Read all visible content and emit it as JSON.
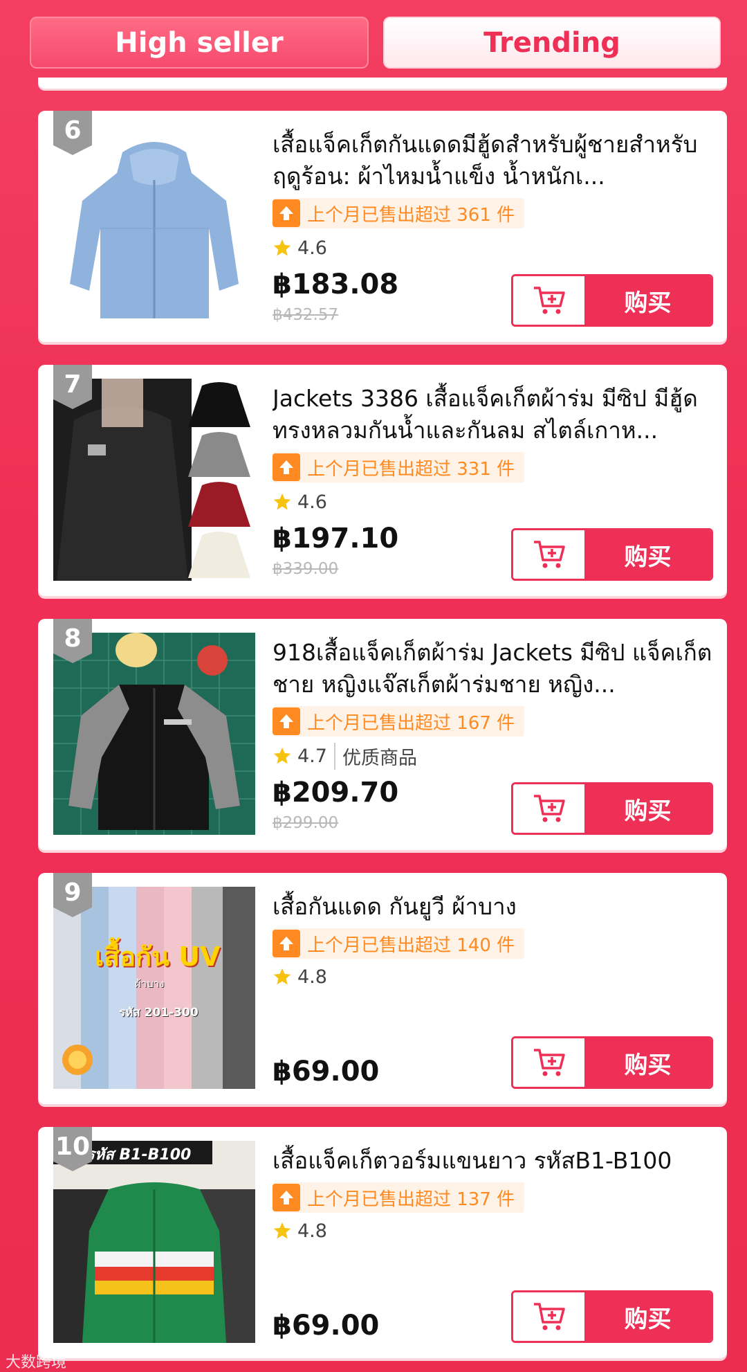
{
  "tabs": {
    "high_seller": "High seller",
    "trending": "Trending"
  },
  "colors": {
    "accent": "#ee2f56",
    "orange": "#ff8a21",
    "rank_badge": "#9a9a9a"
  },
  "buy_label": "购买",
  "products": [
    {
      "rank": "6",
      "title": "เสื้อแจ็คเก็ตกันแดดมีฮู้ดสำหรับผู้ชายสำหรับฤดูร้อน: ผ้าไหมน้ำแข็ง น้ำหนักเ...",
      "sold": "上个月已售出超过 361 件",
      "rating": "4.6",
      "badge": "",
      "price": "฿183.08",
      "old_price": "฿432.57"
    },
    {
      "rank": "7",
      "title": "Jackets 3386 เสื้อแจ็คเก็ตผ้าร่ม มีซิป มีฮู้ดทรงหลวมกันน้ำและกันลม สไตล์เกาห...",
      "sold": "上个月已售出超过 331 件",
      "rating": "4.6",
      "badge": "",
      "price": "฿197.10",
      "old_price": "฿339.00"
    },
    {
      "rank": "8",
      "title": "918เสื้อแจ็คเก็ตผ้าร่ม Jackets มีซิป แจ็คเก็ต ชาย หญิงแจ๊สเก็ตผ้าร่มชาย หญิง...",
      "sold": "上个月已售出超过 167 件",
      "rating": "4.7",
      "badge": "优质商品",
      "price": "฿209.70",
      "old_price": "฿299.00"
    },
    {
      "rank": "9",
      "title": "เสื้อกันแดด กันยูวี ผ้าบาง",
      "sold": "上个月已售出超过 140 件",
      "rating": "4.8",
      "badge": "",
      "price": "฿69.00",
      "old_price": "",
      "thumb_text": {
        "main": "เสื้อกัน UV",
        "sub": "ผ้าบาง",
        "code": "รหัส 201-300"
      }
    },
    {
      "rank": "10",
      "title": "เสื้อแจ็คเก็ตวอร์มแขนยาว รหัสB1-B100",
      "sold": "上个月已售出超过 137 件",
      "rating": "4.8",
      "badge": "",
      "price": "฿69.00",
      "old_price": "",
      "thumb_text": {
        "main": "รหัส B1-B100"
      }
    }
  ],
  "watermark": "大数跨境"
}
